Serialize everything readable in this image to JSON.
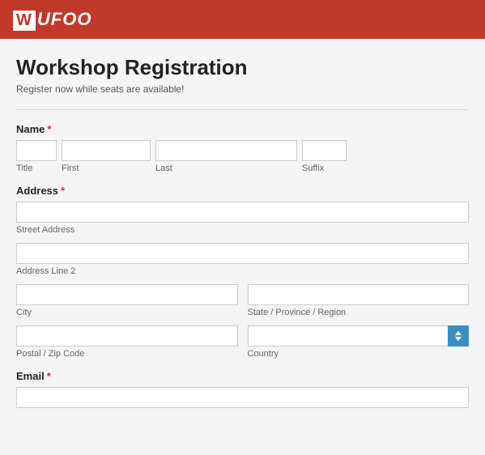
{
  "header": {
    "logo": "WUFOO",
    "logo_w": "W"
  },
  "form": {
    "title": "Workshop Registration",
    "subtitle": "Register now while seats are available!",
    "fields": {
      "name": {
        "label": "Name",
        "required": true,
        "subfields": {
          "title": "Title",
          "first": "First",
          "last": "Last",
          "suffix": "Suffix"
        }
      },
      "address": {
        "label": "Address",
        "required": true,
        "street": "Street Address",
        "line2": "Address Line 2",
        "city": "City",
        "state": "State / Province / Region",
        "zip": "Postal / Zip Code",
        "country": "Country"
      },
      "email": {
        "label": "Email",
        "required": true
      }
    }
  }
}
